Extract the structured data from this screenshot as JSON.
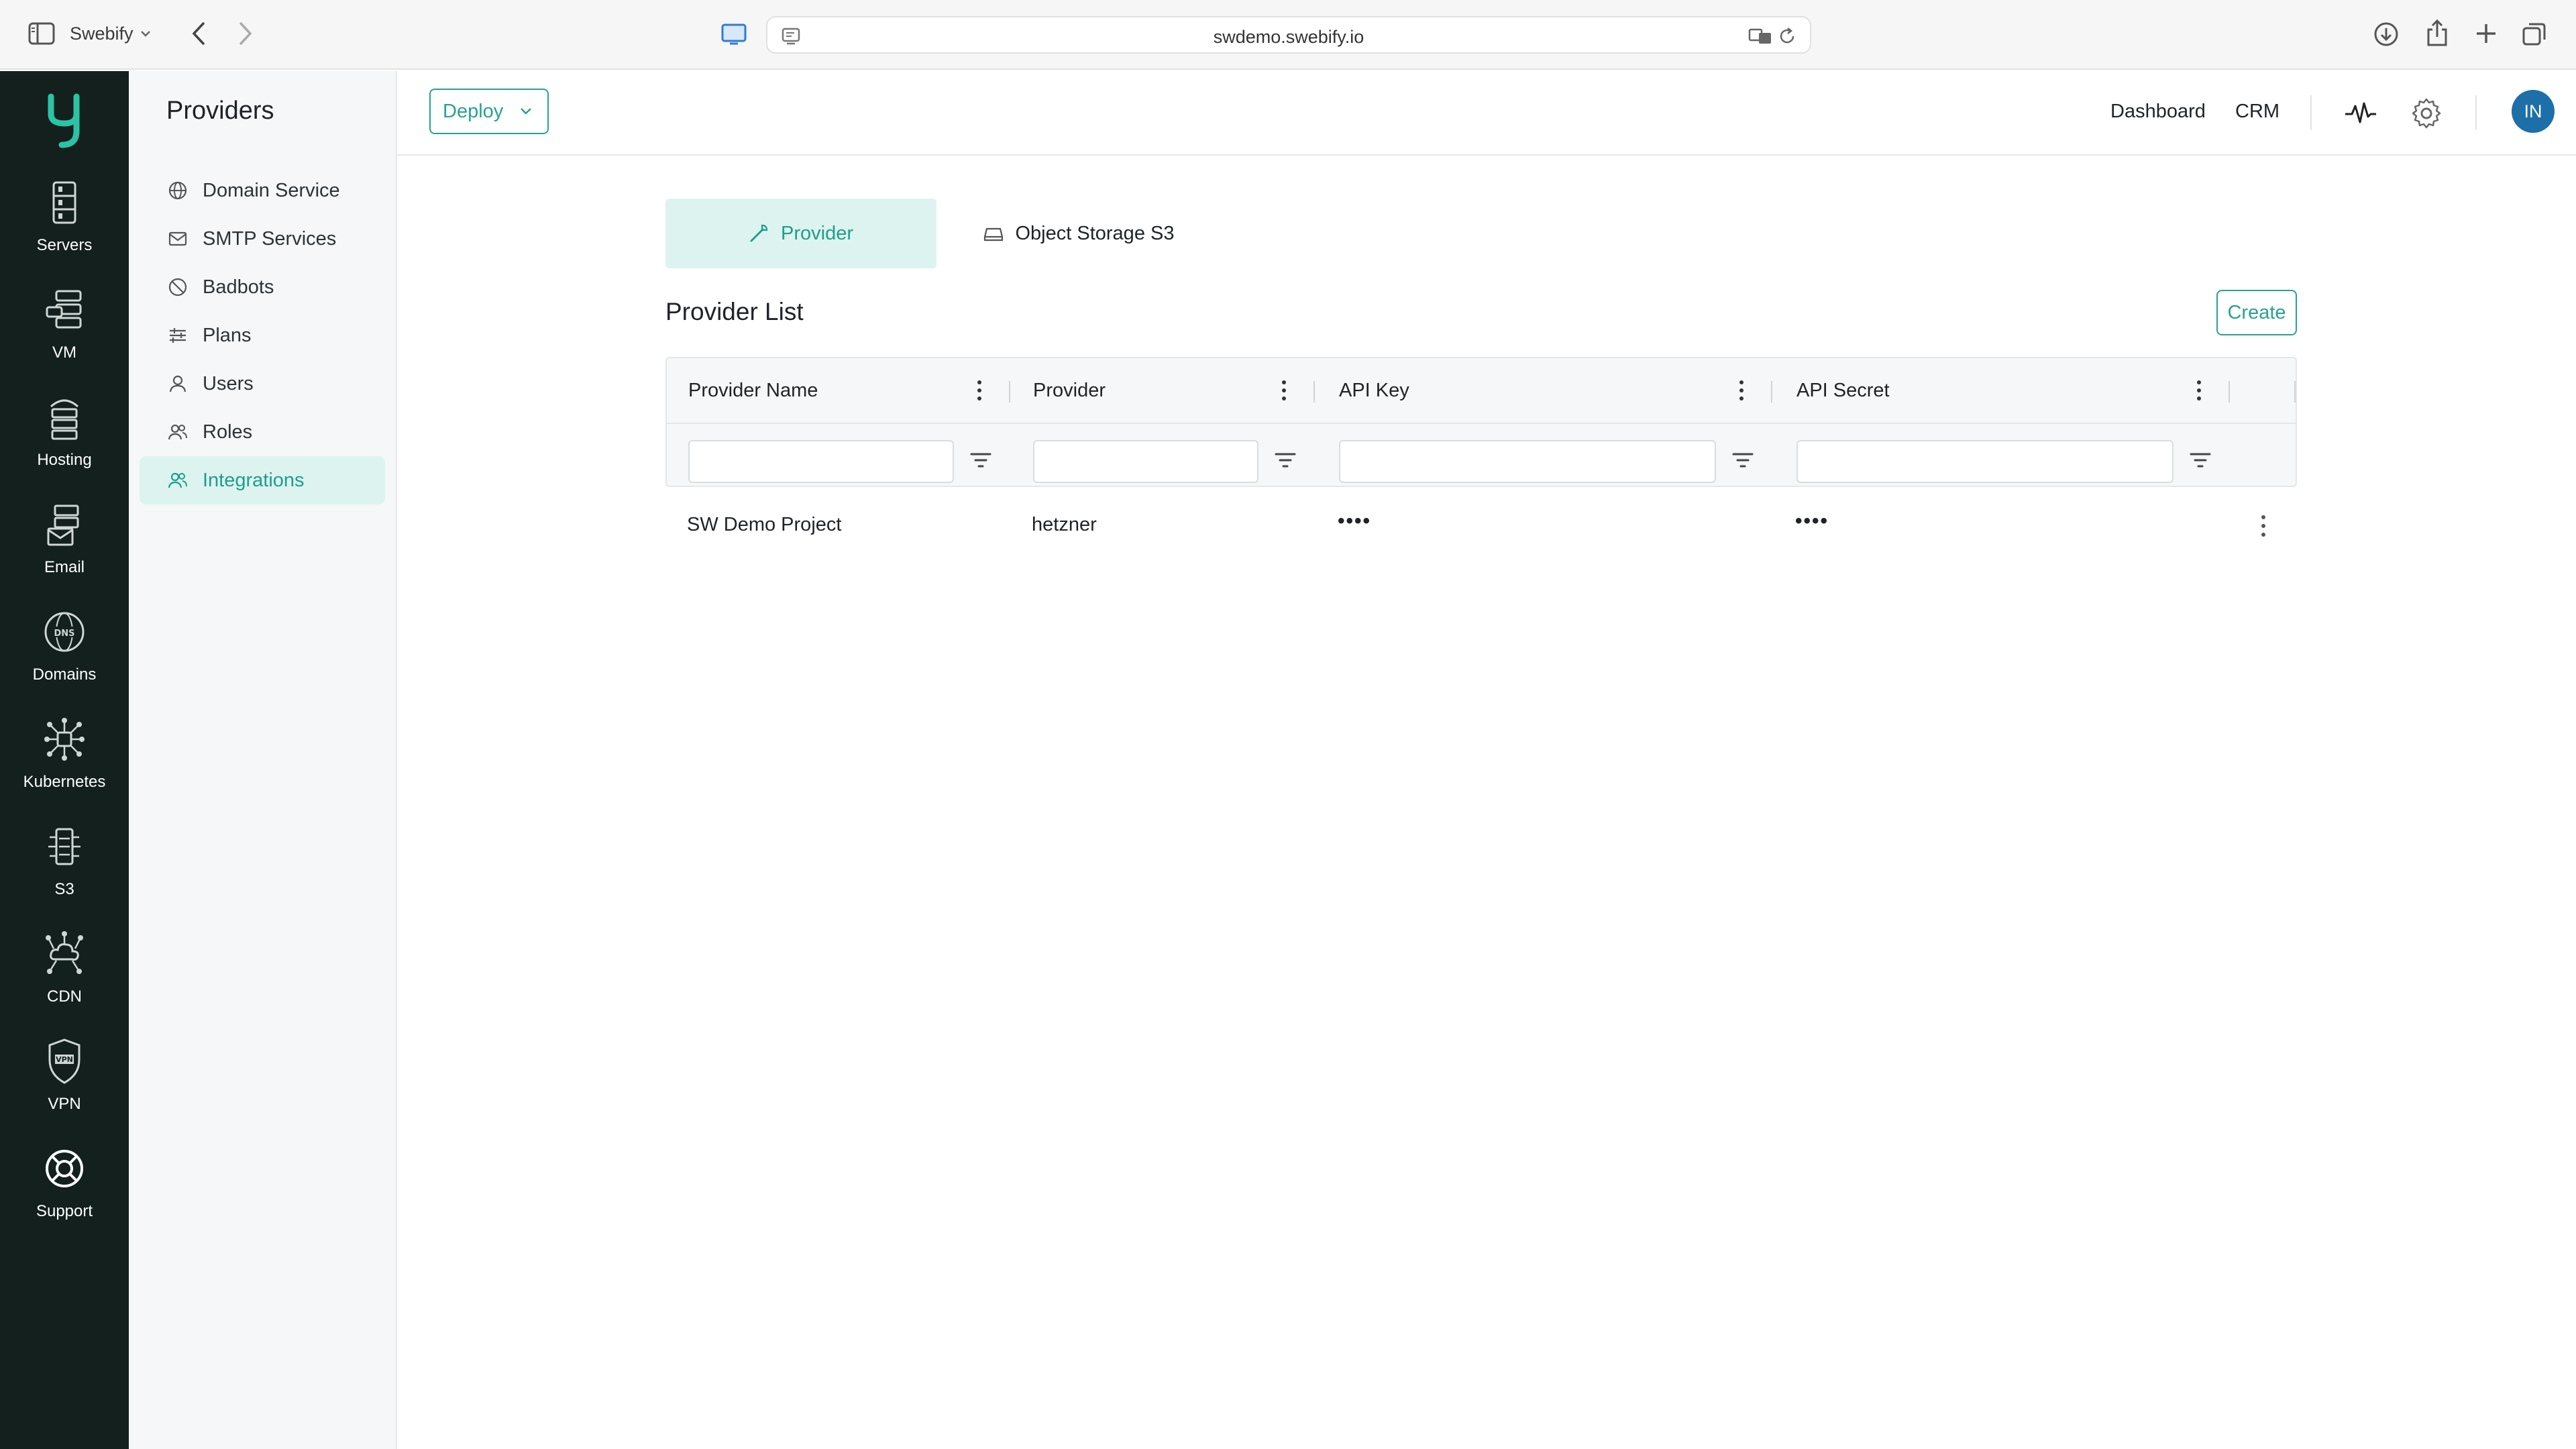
{
  "browser": {
    "profile_name": "Swebify",
    "url": "swdemo.swebify.io"
  },
  "rail": {
    "items": [
      {
        "label": "Servers",
        "icon": "servers-icon"
      },
      {
        "label": "VM",
        "icon": "vm-icon"
      },
      {
        "label": "Hosting",
        "icon": "hosting-icon"
      },
      {
        "label": "Email",
        "icon": "email-icon"
      },
      {
        "label": "Domains",
        "icon": "dns-icon"
      },
      {
        "label": "Kubernetes",
        "icon": "kubernetes-icon"
      },
      {
        "label": "S3",
        "icon": "s3-icon"
      },
      {
        "label": "CDN",
        "icon": "cdn-icon"
      },
      {
        "label": "VPN",
        "icon": "vpn-icon"
      },
      {
        "label": "Support",
        "icon": "support-icon"
      }
    ]
  },
  "sidebar": {
    "title": "Providers",
    "items": [
      {
        "label": "Domain Service",
        "icon": "globe-icon"
      },
      {
        "label": "SMTP Services",
        "icon": "mail-icon"
      },
      {
        "label": "Badbots",
        "icon": "block-icon"
      },
      {
        "label": "Plans",
        "icon": "sliders-icon"
      },
      {
        "label": "Users",
        "icon": "user-icon"
      },
      {
        "label": "Roles",
        "icon": "users-icon"
      },
      {
        "label": "Integrations",
        "icon": "users-icon",
        "active": true
      }
    ]
  },
  "header": {
    "deploy_label": "Deploy",
    "links": [
      "Dashboard",
      "CRM"
    ],
    "avatar_initials": "IN"
  },
  "tabs": [
    {
      "label": "Provider",
      "active": true
    },
    {
      "label": "Object Storage S3",
      "active": false
    }
  ],
  "main": {
    "list_title": "Provider List",
    "create_label": "Create"
  },
  "table": {
    "columns": [
      "Provider Name",
      "Provider",
      "API Key",
      "API Secret"
    ],
    "rows": [
      {
        "provider_name": "SW Demo Project",
        "provider": "hetzner",
        "api_key": "••••",
        "api_secret": "••••"
      }
    ]
  },
  "colors": {
    "accent": "#26a38d",
    "accent_bg": "#ddf3ef",
    "rail_bg": "#13201d",
    "avatar_bg": "#1d6fa8"
  }
}
